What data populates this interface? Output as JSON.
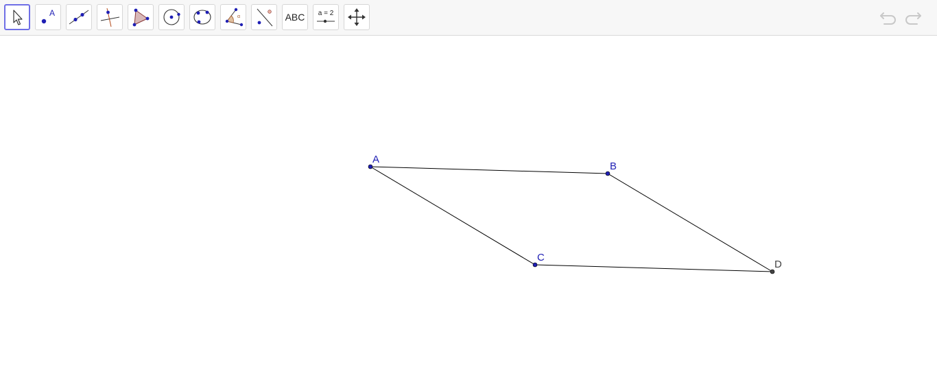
{
  "toolbar": {
    "tools": [
      {
        "name": "move-tool-button",
        "icon": "move-arrow-icon",
        "selected": true
      },
      {
        "name": "point-tool-button",
        "icon": "point-icon",
        "label": "A"
      },
      {
        "name": "line-tool-button",
        "icon": "line-through-points-icon"
      },
      {
        "name": "perpendicular-tool-button",
        "icon": "perpendicular-line-icon"
      },
      {
        "name": "polygon-tool-button",
        "icon": "polygon-icon"
      },
      {
        "name": "circle-tool-button",
        "icon": "circle-center-point-icon"
      },
      {
        "name": "conic-tool-button",
        "icon": "conic-through-points-icon"
      },
      {
        "name": "angle-tool-button",
        "icon": "angle-icon",
        "label": "α"
      },
      {
        "name": "reflect-tool-button",
        "icon": "reflect-about-line-icon"
      },
      {
        "name": "text-tool-button",
        "icon": "text-icon",
        "label": "ABC"
      },
      {
        "name": "slider-tool-button",
        "icon": "slider-icon",
        "label": "a = 2"
      },
      {
        "name": "move-graphics-view-tool-button",
        "icon": "move-graphics-view-icon"
      }
    ],
    "undo_icon": "undo-icon",
    "redo_icon": "redo-icon"
  },
  "construction": {
    "points": [
      {
        "label": "A",
        "color": "#1f1fb4"
      },
      {
        "label": "B",
        "color": "#1f1fb4"
      },
      {
        "label": "C",
        "color": "#1f1fb4"
      },
      {
        "label": "D",
        "color": "#444444"
      }
    ],
    "segment_color": "#000000"
  },
  "colors": {
    "accent_selected": "#6e6ee6",
    "free_point": "#1f1fb4",
    "dependent_point": "#444444"
  }
}
